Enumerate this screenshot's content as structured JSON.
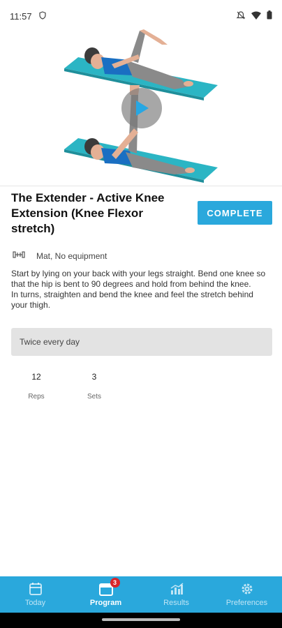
{
  "status_bar": {
    "time": "11:57"
  },
  "exercise": {
    "title": "The Extender - Active Knee Extension (Knee Flexor stretch)",
    "complete_label": "COMPLETE",
    "equipment": "Mat, No equipment",
    "description": "Start by lying on your back with your legs straight. Bend one knee so that the hip is bent to 90 degrees and hold from behind the knee.\nIn turns, straighten and bend the knee and feel the stretch behind your thigh.",
    "frequency": "Twice every day",
    "reps_value": "12",
    "reps_label": "Reps",
    "sets_value": "3",
    "sets_label": "Sets"
  },
  "nav": {
    "today": "Today",
    "program": "Program",
    "program_badge": "3",
    "results": "Results",
    "preferences": "Preferences",
    "active": "program"
  },
  "colors": {
    "accent": "#2aa8dc",
    "mat": "#2bb5c4",
    "badge": "#d9262a"
  }
}
